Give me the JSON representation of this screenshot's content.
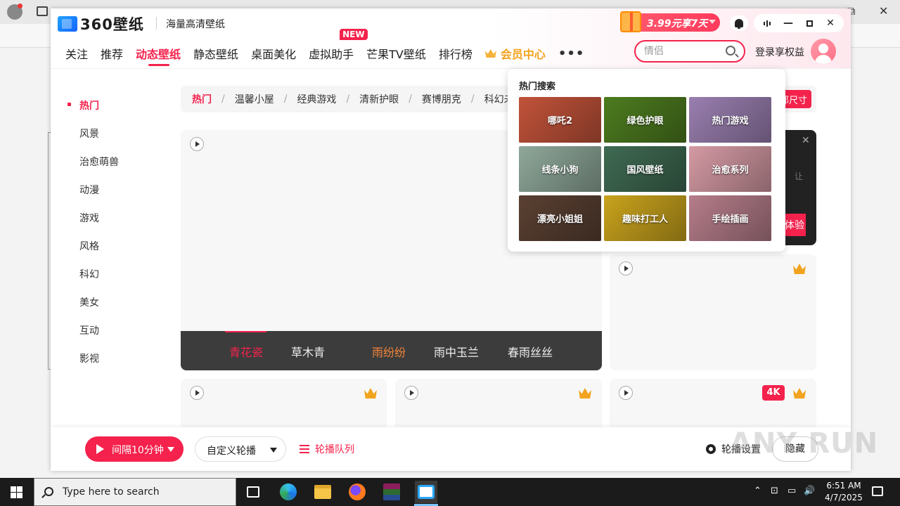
{
  "colors": {
    "accent": "#f4224c",
    "vip": "#f2a31f",
    "dark_strip": "#3c3c3c"
  },
  "app": {
    "logo_text": "360壁纸",
    "slogan": "海量高清壁纸",
    "promo_text": "3.99元享7天",
    "window_controls": [
      "minimize-icon",
      "maximize-icon",
      "close-icon"
    ]
  },
  "nav": {
    "items": [
      {
        "label": "关注"
      },
      {
        "label": "推荐"
      },
      {
        "label": "动态壁纸",
        "active": true
      },
      {
        "label": "静态壁纸"
      },
      {
        "label": "桌面美化"
      },
      {
        "label": "虚拟助手",
        "badge": "NEW"
      },
      {
        "label": "芒果TV壁纸"
      },
      {
        "label": "排行榜"
      }
    ],
    "vip_label": "会员中心",
    "more": "•••"
  },
  "search": {
    "value": "",
    "placeholder": "情侣"
  },
  "login_label": "登录享权益",
  "sidebar": {
    "items": [
      {
        "label": "热门",
        "active": true
      },
      {
        "label": "风景"
      },
      {
        "label": "治愈萌兽"
      },
      {
        "label": "动漫"
      },
      {
        "label": "游戏"
      },
      {
        "label": "风格"
      },
      {
        "label": "科幻"
      },
      {
        "label": "美女"
      },
      {
        "label": "互动"
      },
      {
        "label": "影视"
      }
    ]
  },
  "tags": [
    "热门",
    "温馨小屋",
    "经典游戏",
    "清新护眼",
    "赛博朋克",
    "科幻未来"
  ],
  "size_button": "全部尺寸",
  "hero_options": [
    {
      "label": "青花瓷",
      "state": "active"
    },
    {
      "label": "草木青",
      "state": "normal"
    },
    {
      "label": "雨纷纷",
      "state": "warm"
    },
    {
      "label": "雨中玉兰",
      "state": "normal"
    },
    {
      "label": "春雨丝丝",
      "state": "normal"
    }
  ],
  "dark_card": {
    "button": "体验",
    "glyph": "让"
  },
  "badge_4k": "4K",
  "popup": {
    "title": "热门搜索",
    "tiles": [
      {
        "label": "哪吒2",
        "bg": "#c2533a"
      },
      {
        "label": "绿色护眼",
        "bg": "#4d7c1f"
      },
      {
        "label": "热门游戏",
        "bg": "#9a7fb0"
      },
      {
        "label": "线条小狗",
        "bg": "#8fa89a"
      },
      {
        "label": "国风壁纸",
        "bg": "#3f6a52"
      },
      {
        "label": "治愈系列",
        "bg": "#d59aa4"
      },
      {
        "label": "漂亮小姐姐",
        "bg": "#5a4032"
      },
      {
        "label": "趣味打工人",
        "bg": "#c9a31d"
      },
      {
        "label": "手绘插画",
        "bg": "#b57d8a"
      }
    ]
  },
  "bottom": {
    "interval_label": "间隔10分钟",
    "custom_label": "自定义轮播",
    "queue_label": "轮播队列",
    "settings_label": "轮播设置",
    "hide_label": "隐藏"
  },
  "watermark": "ANY RUN",
  "taskbar": {
    "search_placeholder": "Type here to search",
    "time": "6:51 AM",
    "date": "4/7/2025"
  }
}
